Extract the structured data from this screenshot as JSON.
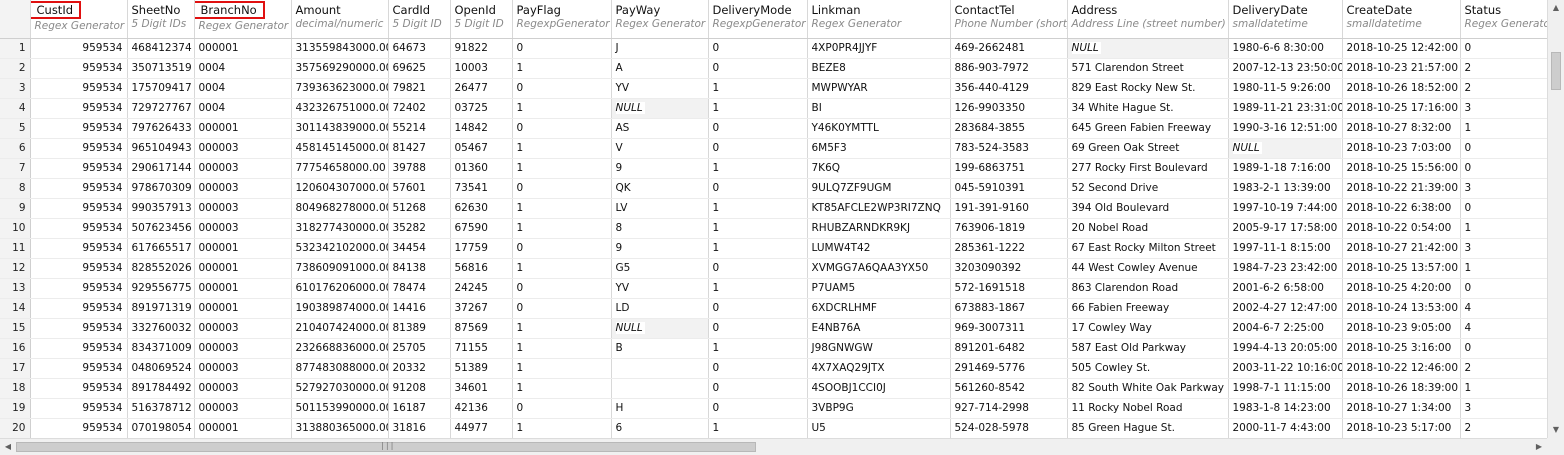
{
  "columns": [
    {
      "name": "CustId",
      "sub": "Regex Generator",
      "align": "num",
      "highlight": true
    },
    {
      "name": "SheetNo",
      "sub": "5 Digit IDs",
      "align": "left",
      "highlight": false
    },
    {
      "name": "BranchNo",
      "sub": "Regex Generator",
      "align": "left",
      "highlight": true
    },
    {
      "name": "Amount",
      "sub": "decimal/numeric",
      "align": "num",
      "highlight": false
    },
    {
      "name": "CardId",
      "sub": "5 Digit ID",
      "align": "left",
      "highlight": false
    },
    {
      "name": "OpenId",
      "sub": "5 Digit ID",
      "align": "left",
      "highlight": false
    },
    {
      "name": "PayFlag",
      "sub": "RegexpGenerator",
      "align": "left",
      "highlight": false
    },
    {
      "name": "PayWay",
      "sub": "Regex Generator",
      "align": "left",
      "highlight": false
    },
    {
      "name": "DeliveryMode",
      "sub": "RegexpGenerator",
      "align": "left",
      "highlight": false
    },
    {
      "name": "Linkman",
      "sub": "Regex Generator",
      "align": "left",
      "highlight": false
    },
    {
      "name": "ContactTel",
      "sub": "Phone Number (short)",
      "align": "left",
      "highlight": false
    },
    {
      "name": "Address",
      "sub": "Address Line (street number)",
      "align": "left",
      "highlight": false
    },
    {
      "name": "DeliveryDate",
      "sub": "smalldatetime",
      "align": "left",
      "highlight": false
    },
    {
      "name": "CreateDate",
      "sub": "smalldatetime",
      "align": "left",
      "highlight": false
    },
    {
      "name": "Status",
      "sub": "Regex Generator",
      "align": "left",
      "highlight": false
    }
  ],
  "null_label": "NULL",
  "rows": [
    [
      "959534",
      "468412374",
      "000001",
      "313559843000.00",
      "64673",
      "91822",
      "0",
      "J",
      "0",
      "4XP0PR4JJYF",
      "469-2662481",
      null,
      "1980-6-6 8:30:00",
      "2018-10-25 12:42:00",
      "0"
    ],
    [
      "959534",
      "350713519",
      "0004",
      "357569290000.00",
      "69625",
      "10003",
      "1",
      "A",
      "0",
      "BEZE8",
      "886-903-7972",
      "571 Clarendon Street",
      "2007-12-13 23:50:00",
      "2018-10-23 21:57:00",
      "2"
    ],
    [
      "959534",
      "175709417",
      "0004",
      "739363623000.00",
      "79821",
      "26477",
      "0",
      "YV",
      "1",
      "MWPWYAR",
      "356-440-4129",
      "829 East Rocky New St.",
      "1980-11-5 9:26:00",
      "2018-10-26 18:52:00",
      "2"
    ],
    [
      "959534",
      "729727767",
      "0004",
      "432326751000.00",
      "72402",
      "03725",
      "1",
      null,
      "1",
      "BI",
      "126-9903350",
      "34 White Hague St.",
      "1989-11-21 23:31:00",
      "2018-10-25 17:16:00",
      "3"
    ],
    [
      "959534",
      "797626433",
      "000001",
      "301143839000.00",
      "55214",
      "14842",
      "0",
      "AS",
      "0",
      "Y46K0YMTTL",
      "283684-3855",
      "645 Green Fabien Freeway",
      "1990-3-16 12:51:00",
      "2018-10-27 8:32:00",
      "1"
    ],
    [
      "959534",
      "965104943",
      "000003",
      "458145145000.00",
      "81427",
      "05467",
      "1",
      "V",
      "0",
      "6M5F3",
      "783-524-3583",
      "69 Green Oak Street",
      null,
      "2018-10-23 7:03:00",
      "0"
    ],
    [
      "959534",
      "290617144",
      "000003",
      "77754658000.00",
      "39788",
      "01360",
      "1",
      "9",
      "1",
      "7K6Q",
      "199-6863751",
      "277 Rocky First Boulevard",
      "1989-1-18 7:16:00",
      "2018-10-25 15:56:00",
      "0"
    ],
    [
      "959534",
      "978670309",
      "000003",
      "120604307000.00",
      "57601",
      "73541",
      "0",
      "QK",
      "0",
      "9ULQ7ZF9UGM",
      "045-5910391",
      "52 Second Drive",
      "1983-2-1 13:39:00",
      "2018-10-22 21:39:00",
      "3"
    ],
    [
      "959534",
      "990357913",
      "000003",
      "804968278000.00",
      "51268",
      "62630",
      "1",
      "LV",
      "1",
      "KT85AFCLE2WP3RI7ZNQ",
      "191-391-9160",
      "394 Old Boulevard",
      "1997-10-19 7:44:00",
      "2018-10-22 6:38:00",
      "0"
    ],
    [
      "959534",
      "507623456",
      "000003",
      "318277430000.00",
      "35282",
      "67590",
      "1",
      "8",
      "1",
      "RHUBZARNDKR9KJ",
      "763906-1819",
      "20 Nobel Road",
      "2005-9-17 17:58:00",
      "2018-10-22 0:54:00",
      "1"
    ],
    [
      "959534",
      "617665517",
      "000001",
      "532342102000.00",
      "34454",
      "17759",
      "0",
      "9",
      "1",
      "LUMW4T42",
      "285361-1222",
      "67 East Rocky Milton Street",
      "1997-11-1 8:15:00",
      "2018-10-27 21:42:00",
      "3"
    ],
    [
      "959534",
      "828552026",
      "000001",
      "738609091000.00",
      "84138",
      "56816",
      "1",
      "G5",
      "0",
      "XVMGG7A6QAA3YX50",
      "3203090392",
      "44 West Cowley Avenue",
      "1984-7-23 23:42:00",
      "2018-10-25 13:57:00",
      "1"
    ],
    [
      "959534",
      "929556775",
      "000001",
      "610176206000.00",
      "78474",
      "24245",
      "0",
      "YV",
      "1",
      "P7UAM5",
      "572-1691518",
      "863 Clarendon Road",
      "2001-6-2 6:58:00",
      "2018-10-25 4:20:00",
      "0"
    ],
    [
      "959534",
      "891971319",
      "000001",
      "190389874000.00",
      "14416",
      "37267",
      "0",
      "LD",
      "0",
      "6XDCRLHMF",
      "673883-1867",
      "66 Fabien Freeway",
      "2002-4-27 12:47:00",
      "2018-10-24 13:53:00",
      "4"
    ],
    [
      "959534",
      "332760032",
      "000003",
      "210407424000.00",
      "81389",
      "87569",
      "1",
      null,
      "0",
      "E4NB76A",
      "969-3007311",
      "17 Cowley Way",
      "2004-6-7 2:25:00",
      "2018-10-23 9:05:00",
      "4"
    ],
    [
      "959534",
      "834371009",
      "000003",
      "232668836000.00",
      "25705",
      "71155",
      "1",
      "B",
      "1",
      "J98GNWGW",
      "891201-6482",
      "587 East Old Parkway",
      "1994-4-13 20:05:00",
      "2018-10-25 3:16:00",
      "0"
    ],
    [
      "959534",
      "048069524",
      "000003",
      "877483088000.00",
      "20332",
      "51389",
      "1",
      "",
      "0",
      "4X7XAQ29JTX",
      "291469-5776",
      "505 Cowley St.",
      "2003-11-22 10:16:00",
      "2018-10-22 12:46:00",
      "2"
    ],
    [
      "959534",
      "891784492",
      "000003",
      "527927030000.00",
      "91208",
      "34601",
      "1",
      "",
      "0",
      "4SOOBJ1CCI0J",
      "561260-8542",
      "82 South White Oak Parkway",
      "1998-7-1 11:15:00",
      "2018-10-26 18:39:00",
      "1"
    ],
    [
      "959534",
      "516378712",
      "000003",
      "501153990000.00",
      "16187",
      "42136",
      "0",
      "H",
      "0",
      "3VBP9G",
      "927-714-2998",
      "11 Rocky Nobel Road",
      "1983-1-8 14:23:00",
      "2018-10-27 1:34:00",
      "3"
    ],
    [
      "959534",
      "070198054",
      "000001",
      "313880365000.00",
      "31816",
      "44977",
      "1",
      "6",
      "1",
      "U5",
      "524-028-5978",
      "85 Green Hague St.",
      "2000-11-7 4:43:00",
      "2018-10-23 5:17:00",
      "2"
    ]
  ],
  "scrollbar": {
    "up_icon": "arrow-up-icon",
    "down_icon": "arrow-down-icon",
    "left_icon": "arrow-left-icon",
    "right_icon": "arrow-right-icon",
    "up": "▲",
    "down": "▼",
    "left": "◀",
    "right": "▶",
    "grip": "|||"
  }
}
